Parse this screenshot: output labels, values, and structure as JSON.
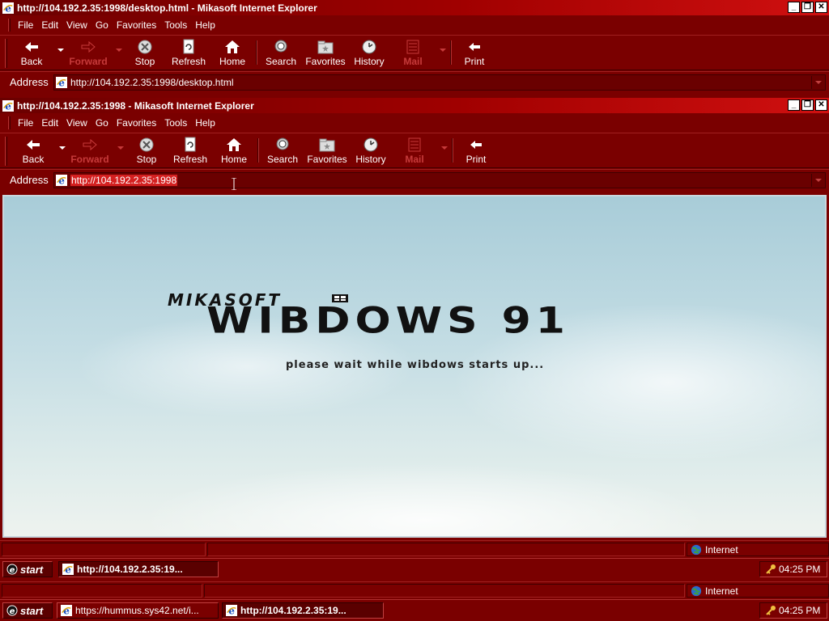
{
  "outer_window": {
    "title": "http://104.192.2.35:1998/desktop.html - Mikasoft Internet Explorer",
    "menu": [
      "File",
      "Edit",
      "View",
      "Go",
      "Favorites",
      "Tools",
      "Help"
    ],
    "toolbar": {
      "back": "Back",
      "forward": "Forward",
      "stop": "Stop",
      "refresh": "Refresh",
      "home": "Home",
      "search": "Search",
      "favorites": "Favorites",
      "history": "History",
      "mail": "Mail",
      "print": "Print"
    },
    "address_label": "Address",
    "address_value": "http://104.192.2.35:1998/desktop.html"
  },
  "inner_window": {
    "title": "http://104.192.2.35:1998 - Mikasoft Internet Explorer",
    "menu": [
      "File",
      "Edit",
      "View",
      "Go",
      "Favorites",
      "Tools",
      "Help"
    ],
    "toolbar": {
      "back": "Back",
      "forward": "Forward",
      "stop": "Stop",
      "refresh": "Refresh",
      "home": "Home",
      "search": "Search",
      "favorites": "Favorites",
      "history": "History",
      "mail": "Mail",
      "print": "Print"
    },
    "address_label": "Address",
    "address_value": "http://104.192.2.35:1998"
  },
  "page": {
    "brand_small": "MIKASOFT",
    "brand_big": "WIBDOWS 91",
    "loading_text": "please wait while wibdows starts up..."
  },
  "inner_status": {
    "zone": "Internet"
  },
  "inner_taskbar": {
    "start": "start",
    "task": "http://104.192.2.35:19...",
    "clock": "04:25 PM"
  },
  "outer_status": {
    "zone": "Internet"
  },
  "outer_taskbar": {
    "start": "start",
    "tasks": [
      "https://hummus.sys42.net/i...",
      "http://104.192.2.35:19..."
    ],
    "clock": "04:25 PM"
  },
  "colors": {
    "chrome": "#7a0000",
    "title_gradient_end": "#d01010",
    "disabled_text": "#c63a3a",
    "selection": "#d42020"
  },
  "icons": [
    "ie-icon",
    "back-icon",
    "forward-icon",
    "stop-icon",
    "refresh-icon",
    "home-icon",
    "search-icon",
    "favorites-icon",
    "history-icon",
    "mail-icon",
    "print-icon",
    "globe-icon",
    "key-icon",
    "windows-logo-icon",
    "flag-icon"
  ]
}
